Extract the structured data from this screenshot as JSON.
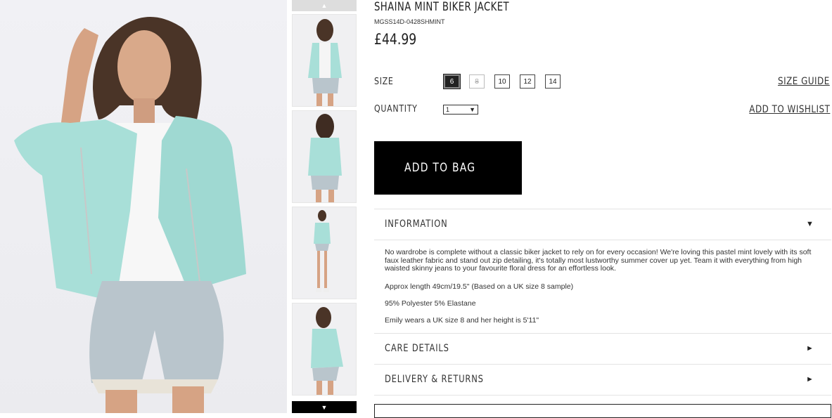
{
  "product": {
    "title": "SHAINA MINT BIKER JACKET",
    "sku": "MGSS14D-0428SHMINT",
    "price": "£44.99"
  },
  "thumbnails": {
    "up_arrow": "▲",
    "down_arrow": "▼",
    "count": 4
  },
  "size": {
    "label": "SIZE",
    "options": [
      "6",
      "8",
      "10",
      "12",
      "14"
    ],
    "selected": "6",
    "unavailable": [
      "8"
    ],
    "guide_label": "SIZE GUIDE"
  },
  "quantity": {
    "label": "QUANTITY",
    "value": "1",
    "arrow": "▼",
    "wishlist_label": "ADD TO WISHLIST"
  },
  "add_to_bag": "ADD TO BAG",
  "accordion": {
    "information": {
      "title": "INFORMATION",
      "icon": "▼",
      "paragraphs": [
        "No wardrobe is complete without a classic biker jacket to rely on for every occasion! We're loving this pastel mint lovely with its soft faux leather fabric and stand out zip detailing, it's totally most lustworthy summer cover up yet. Team it with everything from high waisted skinny jeans to your favourite floral dress for an effortless look.",
        "Approx length 49cm/19.5\" (Based on a UK size 8 sample)",
        "95% Polyester 5% Elastane",
        "Emily wears a UK size 8 and her height is 5'11\""
      ]
    },
    "care": {
      "title": "CARE DETAILS",
      "icon": "►"
    },
    "delivery": {
      "title": "DELIVERY & RETURNS",
      "icon": "►"
    }
  },
  "colors": {
    "jacket_mint": "#a8dfd8",
    "black": "#000000"
  }
}
